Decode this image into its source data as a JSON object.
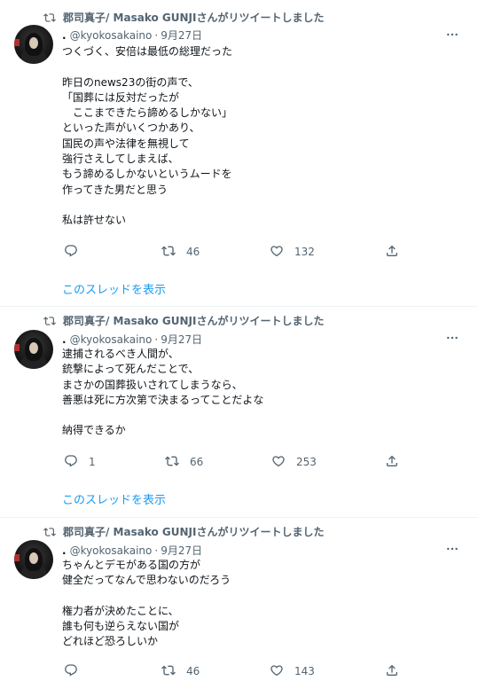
{
  "colors": {
    "text": "#0f1419",
    "secondary": "#536471",
    "link": "#1d9bf0",
    "divider": "#eff3f4"
  },
  "tweets": [
    {
      "retweeted_by": "郡司真子/ Masako GUNJIさんがリツイートしました",
      "display_name": ".",
      "handle": "@kyokosakaino",
      "date": "9月27日",
      "text": "つくづく、安倍は最低の総理だった\n\n昨日のnews23の街の声で、\n「国葬には反対だったが\n　ここまできたら諦めるしかない」\nといった声がいくつかあり、\n国民の声や法律を無視して\n強行さえしてしまえば、\nもう諦めるしかないというムードを\n作ってきた男だと思う\n\n私は許せない",
      "reply_count": "",
      "retweet_count": "46",
      "like_count": "132",
      "thread_link": "このスレッドを表示"
    },
    {
      "retweeted_by": "郡司真子/ Masako GUNJIさんがリツイートしました",
      "display_name": ".",
      "handle": "@kyokosakaino",
      "date": "9月27日",
      "text": "逮捕されるべき人間が、\n銃撃によって死んだことで、\nまさかの国葬扱いされてしまうなら、\n善悪は死に方次第で決まるってことだよな\n\n納得できるか",
      "reply_count": "1",
      "retweet_count": "66",
      "like_count": "253",
      "thread_link": "このスレッドを表示"
    },
    {
      "retweeted_by": "郡司真子/ Masako GUNJIさんがリツイートしました",
      "display_name": ".",
      "handle": "@kyokosakaino",
      "date": "9月27日",
      "text": "ちゃんとデモがある国の方が\n健全だってなんで思わないのだろう\n\n権力者が決めたことに、\n誰も何も逆らえない国が\nどれほど恐ろしいか",
      "reply_count": "",
      "retweet_count": "46",
      "like_count": "143"
    }
  ],
  "icons": {
    "retweet_label": "retweet-icon",
    "reply": "reply-icon",
    "retweet": "retweet-icon",
    "like": "heart-icon",
    "share": "share-icon",
    "more": "more-icon"
  }
}
